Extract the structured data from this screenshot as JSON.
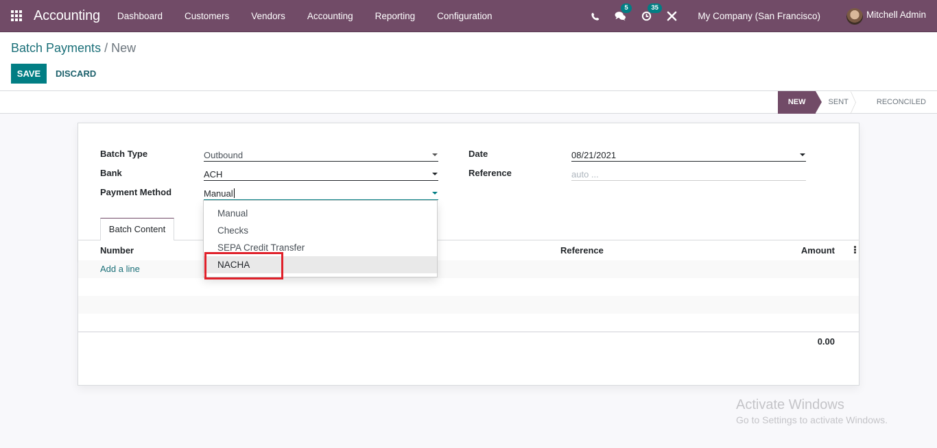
{
  "navbar": {
    "app_title": "Accounting",
    "menu": [
      "Dashboard",
      "Customers",
      "Vendors",
      "Accounting",
      "Reporting",
      "Configuration"
    ],
    "messages_count": "5",
    "activities_count": "35",
    "company": "My Company (San Francisco)",
    "user": "Mitchell Admin",
    "brand_color": "#714b67"
  },
  "control_panel": {
    "breadcrumb_parent": "Batch Payments",
    "breadcrumb_separator": " / ",
    "breadcrumb_current": "New",
    "save_label": "SAVE",
    "discard_label": "DISCARD",
    "primary_color": "#017e84"
  },
  "status": {
    "stages": [
      "NEW",
      "SENT",
      "RECONCILED"
    ],
    "active": "NEW"
  },
  "form": {
    "batch_type_label": "Batch Type",
    "batch_type_value": "Outbound",
    "bank_label": "Bank",
    "bank_value": "ACH",
    "payment_method_label": "Payment Method",
    "payment_method_value": "Manual",
    "date_label": "Date",
    "date_value": "08/21/2021",
    "reference_label": "Reference",
    "reference_placeholder": "auto ..."
  },
  "dropdown": {
    "options": [
      "Manual",
      "Checks",
      "SEPA Credit Transfer",
      "NACHA"
    ],
    "hovered": "NACHA"
  },
  "notebook": {
    "tab": "Batch Content"
  },
  "table": {
    "columns": [
      "Number",
      "Reference",
      "Amount"
    ],
    "add_line": "Add a line",
    "total": "0.00"
  },
  "watermark": {
    "title": "Activate Windows",
    "subtitle": "Go to Settings to activate Windows."
  }
}
